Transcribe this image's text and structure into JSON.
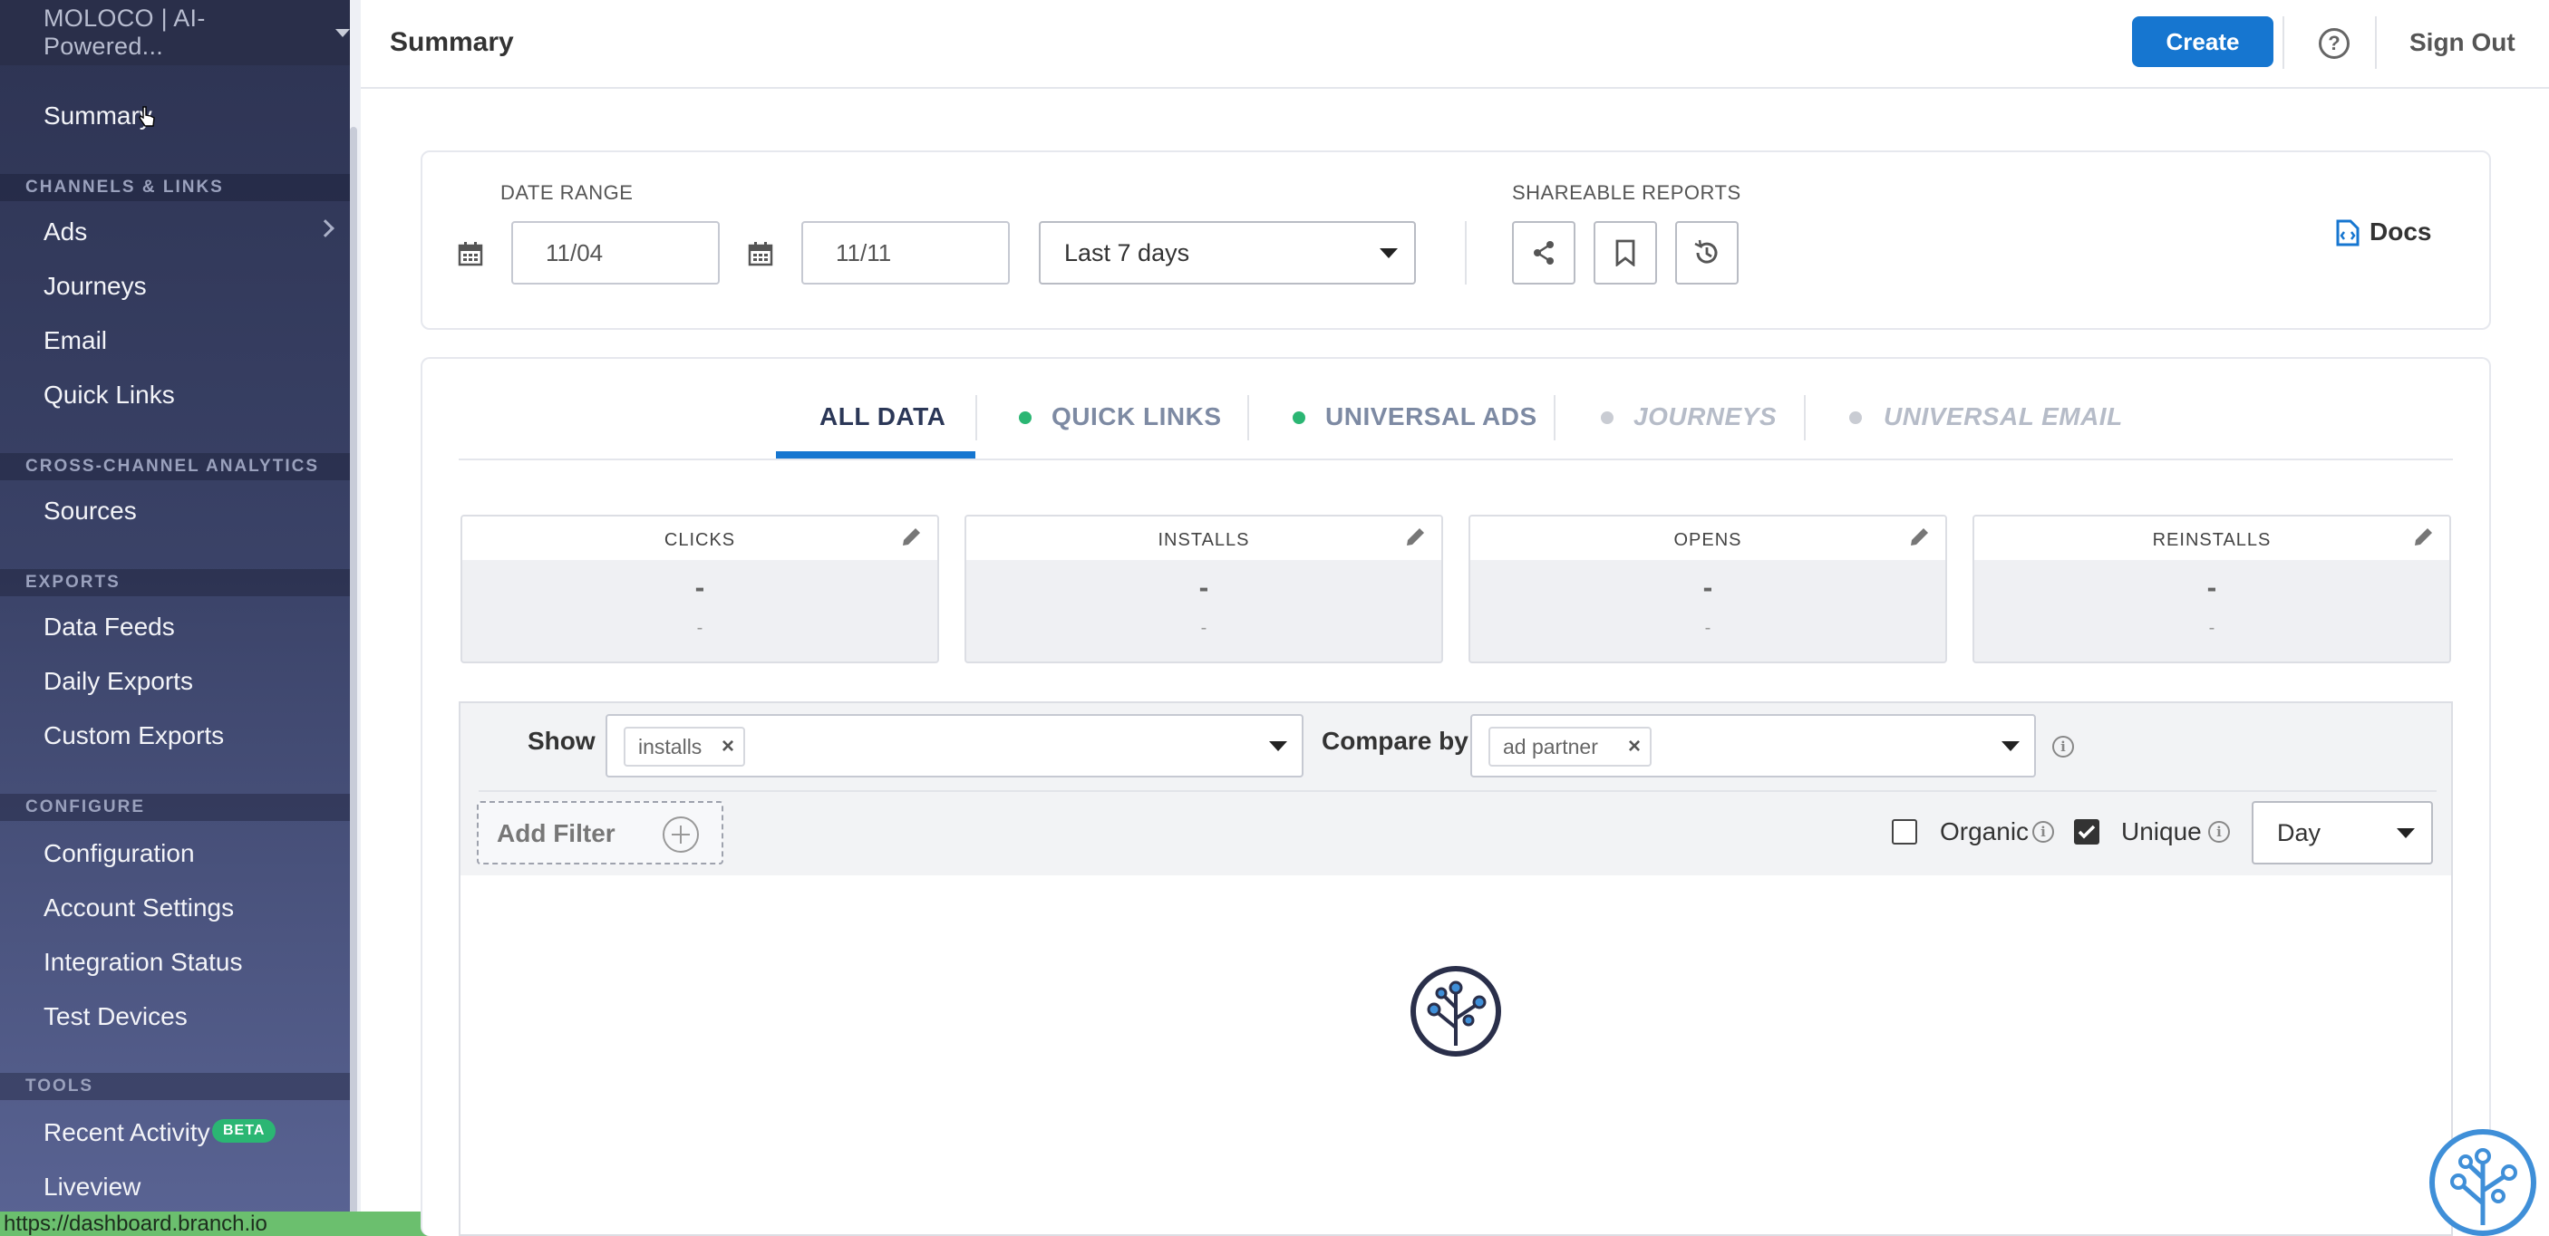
{
  "org": {
    "name": "MOLOCO | AI-Powered..."
  },
  "sidebar": {
    "top_item": "Summary",
    "sections": [
      {
        "title": "CHANNELS & LINKS",
        "items": [
          "Ads",
          "Journeys",
          "Email",
          "Quick Links"
        ]
      },
      {
        "title": "CROSS-CHANNEL ANALYTICS",
        "items": [
          "Sources"
        ]
      },
      {
        "title": "EXPORTS",
        "items": [
          "Data Feeds",
          "Daily Exports",
          "Custom Exports"
        ]
      },
      {
        "title": "CONFIGURE",
        "items": [
          "Configuration",
          "Account Settings",
          "Integration Status",
          "Test Devices"
        ]
      },
      {
        "title": "TOOLS",
        "items": [
          "Recent Activity",
          "Liveview"
        ]
      }
    ],
    "beta_badge": "BETA"
  },
  "status_url": "https://dashboard.branch.io",
  "header": {
    "title": "Summary",
    "create_label": "Create",
    "help_icon": "?",
    "signout_label": "Sign Out"
  },
  "date_range": {
    "label": "DATE RANGE",
    "start": "11/04",
    "end": "11/11",
    "preset": "Last 7 days",
    "shareable_label": "SHAREABLE REPORTS",
    "docs_label": "Docs"
  },
  "tabs": [
    {
      "label": "ALL DATA",
      "active": true,
      "dot": ""
    },
    {
      "label": "QUICK LINKS",
      "active": false,
      "dot": "#2bb673"
    },
    {
      "label": "UNIVERSAL ADS",
      "active": false,
      "dot": "#2bb673"
    },
    {
      "label": "JOURNEYS",
      "active": false,
      "dot": "#c9ccd3"
    },
    {
      "label": "UNIVERSAL EMAIL",
      "active": false,
      "dot": "#c9ccd3"
    }
  ],
  "metrics": [
    {
      "label": "CLICKS",
      "value": "-",
      "sub": "-"
    },
    {
      "label": "INSTALLS",
      "value": "-",
      "sub": "-"
    },
    {
      "label": "OPENS",
      "value": "-",
      "sub": "-"
    },
    {
      "label": "REINSTALLS",
      "value": "-",
      "sub": "-"
    }
  ],
  "filters": {
    "show_label": "Show",
    "show_chip": "installs",
    "compare_label": "Compare by",
    "compare_chip": "ad partner",
    "add_filter_label": "Add Filter",
    "organic_label": "Organic",
    "organic_checked": false,
    "unique_label": "Unique",
    "unique_checked": true,
    "granularity": "Day"
  },
  "colors": {
    "accent": "#1676d0",
    "sidebar": "#3a4267",
    "live_dot": "#2bb673",
    "beta": "#2bb673"
  }
}
